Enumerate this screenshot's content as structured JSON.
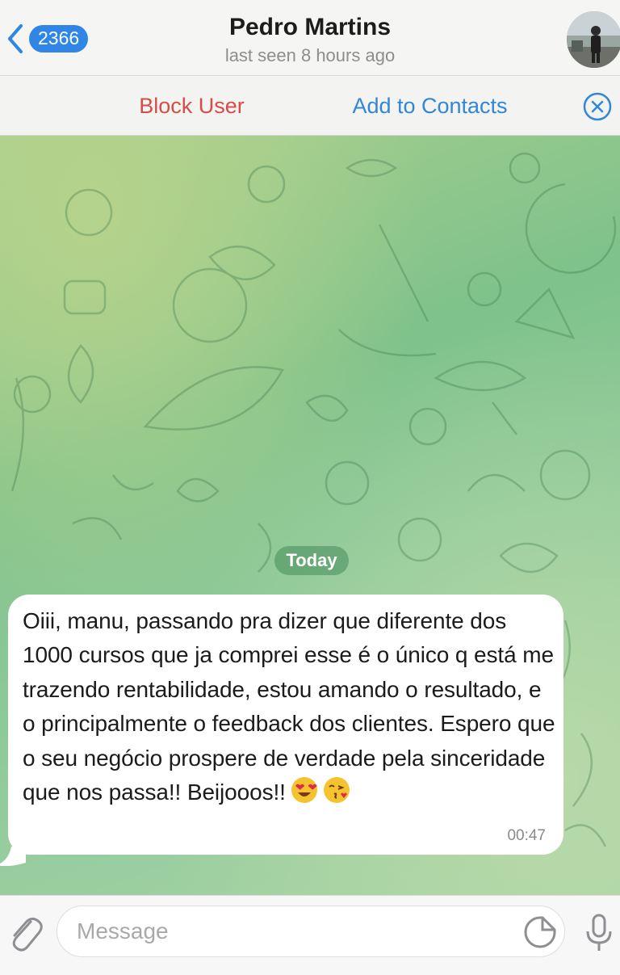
{
  "header": {
    "back_badge": "2366",
    "contact_name": "Pedro Martins",
    "last_seen": "last seen 8 hours ago",
    "avatar_icon": "contact-avatar-photo"
  },
  "action_bar": {
    "block_user": "Block User",
    "add_to_contacts": "Add to Contacts",
    "close_icon": "close-circle-icon"
  },
  "chat": {
    "date_label": "Today",
    "messages": [
      {
        "text": "Oiii, manu, passando pra dizer que diferente dos 1000 cursos que ja comprei esse é o único q está me trazendo rentabilidade, estou amando o resultado, e o principalmente o feedback dos clientes. Espero que o seu negócio prospere de verdade pela sinceridade que nos passa!! Beijooos!!",
        "emojis": [
          "heart-eyes-emoji",
          "kissing-heart-emoji"
        ],
        "time": "00:47"
      }
    ]
  },
  "input": {
    "placeholder": "Message",
    "value": ""
  },
  "colors": {
    "accent_blue": "#2f86e6",
    "block_red": "#d74c48",
    "link_blue": "#3286d6",
    "chat_green": "#7fc28b"
  }
}
